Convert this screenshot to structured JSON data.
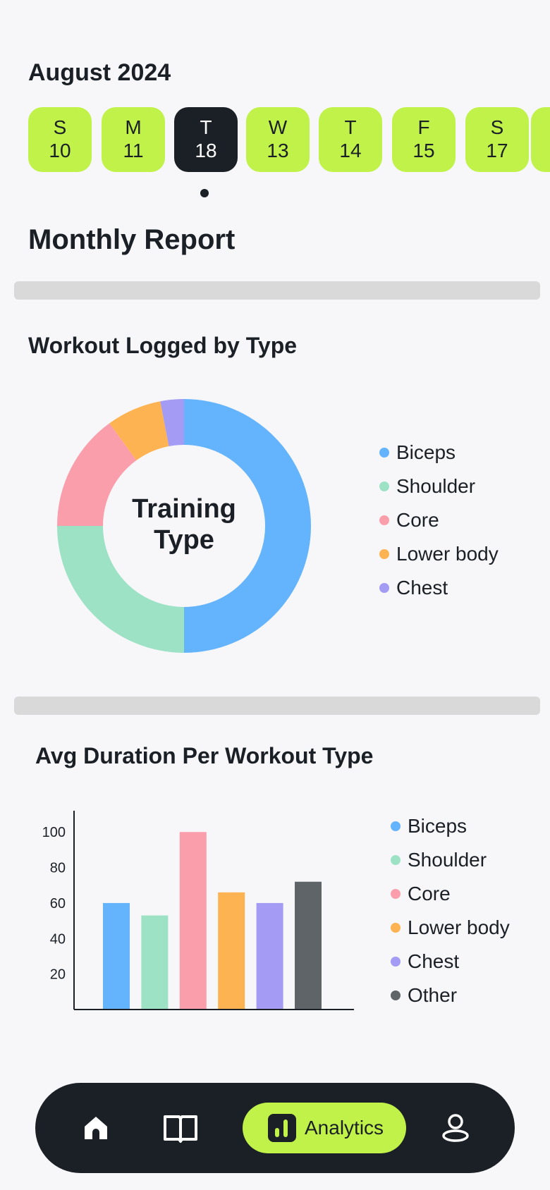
{
  "header": {
    "month": "August 2024"
  },
  "dates": [
    {
      "day": "S",
      "num": "10",
      "active": false
    },
    {
      "day": "M",
      "num": "11",
      "active": false
    },
    {
      "day": "T",
      "num": "18",
      "active": true
    },
    {
      "day": "W",
      "num": "13",
      "active": false
    },
    {
      "day": "T",
      "num": "14",
      "active": false
    },
    {
      "day": "F",
      "num": "15",
      "active": false
    },
    {
      "day": "S",
      "num": "17",
      "active": false
    },
    {
      "day": "",
      "num": "",
      "active": false
    }
  ],
  "report": {
    "title": "Monthly Report"
  },
  "colors": {
    "biceps": "#64b3fd",
    "shoulder": "#9ee2c6",
    "core": "#fb9eab",
    "lower_body": "#feb352",
    "chest": "#a39bf4",
    "other": "#5f6468",
    "accent": "#c0f24a",
    "dark": "#1b2026"
  },
  "donut_card": {
    "title": "Workout Logged by Type",
    "center_line1": "Training",
    "center_line2": "Type"
  },
  "bar_card": {
    "title": "Avg Duration Per Workout Type"
  },
  "chart_data": [
    {
      "type": "pie",
      "title": "Workout Logged by Type",
      "categories": [
        "Biceps",
        "Shoulder",
        "Core",
        "Lower body",
        "Chest"
      ],
      "values": [
        50,
        25,
        15,
        7,
        3
      ],
      "colors": [
        "#64b3fd",
        "#9ee2c6",
        "#fb9eab",
        "#feb352",
        "#a39bf4"
      ],
      "donut": true,
      "center_text": "Training Type",
      "legend": "right"
    },
    {
      "type": "bar",
      "title": "Avg Duration Per Workout Type",
      "categories": [
        "Biceps",
        "Shoulder",
        "Core",
        "Lower body",
        "Chest",
        "Other"
      ],
      "values": [
        60,
        53,
        100,
        66,
        60,
        72
      ],
      "colors": [
        "#64b3fd",
        "#9ee2c6",
        "#fb9eab",
        "#feb352",
        "#a39bf4",
        "#5f6468"
      ],
      "yticks": [
        20,
        40,
        60,
        80,
        100
      ],
      "ylim": [
        0,
        112
      ],
      "xlabel": "",
      "ylabel": "",
      "grid": false,
      "legend": "right"
    }
  ],
  "nav": {
    "items": [
      {
        "name": "home",
        "icon": "home-icon"
      },
      {
        "name": "library",
        "icon": "book-icon"
      },
      {
        "name": "analytics",
        "icon": "bar-chart-icon",
        "label": "Analytics",
        "active": true
      },
      {
        "name": "profile",
        "icon": "user-icon"
      }
    ]
  }
}
